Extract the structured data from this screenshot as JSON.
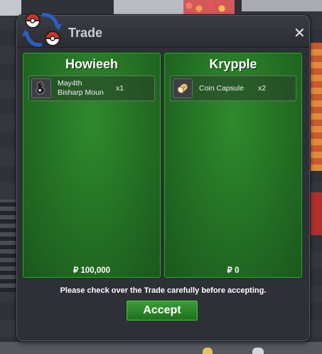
{
  "window": {
    "title": "Trade",
    "close_icon": "close-icon",
    "logo_icon": "trade-pokeball-icon"
  },
  "left_panel": {
    "player_name": "Howieeh",
    "items": [
      {
        "line1": "May4th",
        "line2": "Bisharp Moun",
        "quantity": "x1",
        "icon": "bisharp-mount-icon"
      }
    ],
    "currency_symbol": "₽",
    "money": "100,000"
  },
  "right_panel": {
    "player_name": "Krypple",
    "items": [
      {
        "name": "Coin Capsule",
        "quantity": "x2",
        "icon": "coin-capsule-icon"
      }
    ],
    "currency_symbol": "₽",
    "money": "0"
  },
  "notice": "Please check over the Trade carefully before accepting.",
  "accept_label": "Accept",
  "colors": {
    "panel_green": "#236e23",
    "window_bg": "#2f3037",
    "title_text": "#c9ccd4",
    "accept_green": "#2d8a2b"
  }
}
